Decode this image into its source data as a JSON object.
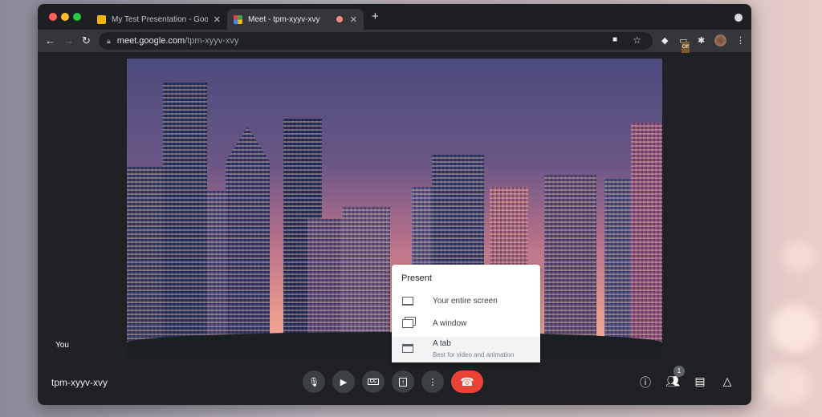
{
  "browser": {
    "tabs": [
      {
        "title": "My Test Presentation - Google",
        "active": false,
        "favicon_color": "#f4b400"
      },
      {
        "title": "Meet - tpm-xyyv-xvy",
        "active": true,
        "recording": true
      }
    ],
    "url_host": "meet.google.com",
    "url_path": "/tpm-xyyv-xvy",
    "extension_badge": "Off"
  },
  "meet": {
    "self_label": "You",
    "meeting_code": "tpm-xyyv-xvy",
    "participant_count": "1",
    "present_menu": {
      "title": "Present",
      "items": [
        {
          "label": "Your entire screen",
          "icon": "laptop-icon"
        },
        {
          "label": "A window",
          "icon": "window-icon"
        },
        {
          "label": "A tab",
          "subtitle": "Best for video and animation",
          "icon": "tab-icon",
          "highlighted": true
        }
      ]
    },
    "colors": {
      "end_call": "#ea4335",
      "bar": "#202124"
    }
  }
}
